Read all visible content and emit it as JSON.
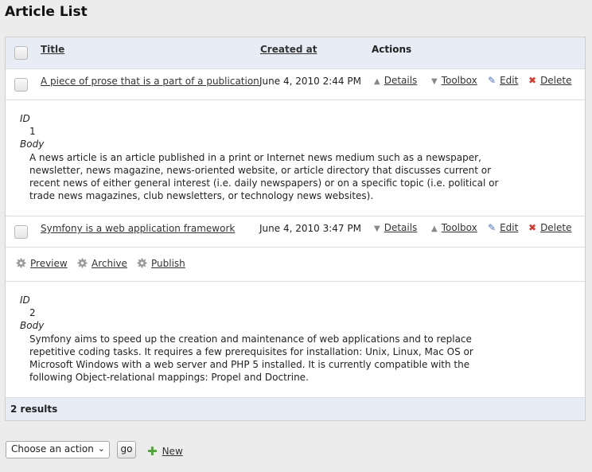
{
  "page": {
    "title": "Article List"
  },
  "table": {
    "columns": {
      "title": "Title",
      "created_at": "Created at",
      "actions": "Actions"
    },
    "actions": {
      "details": "Details",
      "toolbox": "Toolbox",
      "edit": "Edit",
      "delete": "Delete"
    },
    "rows": [
      {
        "title": "A piece of prose that is a part of a publication",
        "created_at": "June 4, 2010 2:44 PM",
        "id_label": "ID",
        "id": "1",
        "body_label": "Body",
        "body": "A news article is an article published in a print or Internet news medium such as a newspaper, newsletter, news magazine, news-oriented website, or article directory that discusses current or recent news of either general interest (i.e. daily newspapers) or on a specific topic (i.e. political or trade news magazines, club newsletters, or technology news websites)."
      },
      {
        "title": "Symfony is a web application framework",
        "created_at": "June 4, 2010 3:47 PM",
        "id_label": "ID",
        "id": "2",
        "body_label": "Body",
        "body": "Symfony aims to speed up the creation and maintenance of web applications and to replace repetitive coding tasks. It requires a few prerequisites for installation: Unix, Linux, Mac OS or Microsoft Windows with a web server and PHP 5 installed. It is currently compatible with the following Object-relational mappings: Propel and Doctrine."
      }
    ],
    "toolbox_actions": {
      "preview": "Preview",
      "archive": "Archive",
      "publish": "Publish"
    },
    "footer": "2 results"
  },
  "batch": {
    "select_value": "Choose an action",
    "go_label": "go",
    "new_label": "New"
  },
  "colors": {
    "header_bg": "#e8edf5",
    "delete_icon": "#d43b2f",
    "edit_icon": "#4a70b8",
    "new_icon": "#52a33b"
  }
}
